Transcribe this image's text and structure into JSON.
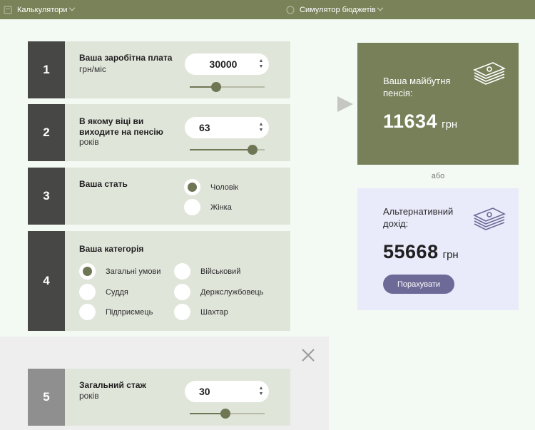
{
  "nav": {
    "calculators_label": "Калькулятори",
    "simulator_label": "Симулятор бюджетів"
  },
  "steps": [
    {
      "number": "1",
      "title": "Ваша заробітна плата",
      "subtitle": "грн/міс",
      "value": "30000",
      "slider_fraction": 0.35
    },
    {
      "number": "2",
      "title": "В якому віці ви виходите на пенсію",
      "subtitle": "років",
      "value": "63",
      "slider_fraction": 0.84
    },
    {
      "number": "3",
      "title": "Ваша стать",
      "options": [
        {
          "label": "Чоловік",
          "selected": true
        },
        {
          "label": "Жінка",
          "selected": false
        }
      ]
    },
    {
      "number": "4",
      "title": "Ваша категорія",
      "options": [
        {
          "label": "Загальні умови",
          "selected": true
        },
        {
          "label": "Військовий",
          "selected": false
        },
        {
          "label": "Суддя",
          "selected": false
        },
        {
          "label": "Держслужбовець",
          "selected": false
        },
        {
          "label": "Підприємець",
          "selected": false
        },
        {
          "label": "Шахтар",
          "selected": false
        }
      ]
    },
    {
      "number": "5",
      "title": "Загальний стаж",
      "subtitle": "років",
      "value": "30",
      "slider_fraction": 0.48
    }
  ],
  "result": {
    "pension_label": "Ваша майбутня пенсія:",
    "pension_value": "11634",
    "currency": "грн",
    "or_label": "або",
    "alt_label": "Альтернативний дохід:",
    "alt_value": "55668",
    "calc_button": "Порахувати"
  },
  "icons": {
    "stepper_up": "▲",
    "stepper_down": "▼"
  },
  "colors": {
    "accent_green": "#78805a",
    "step_dark": "#474745",
    "card_bg": "#e0e5da",
    "button_purple": "#6e6a98",
    "alt_panel": "#e9eafa"
  }
}
